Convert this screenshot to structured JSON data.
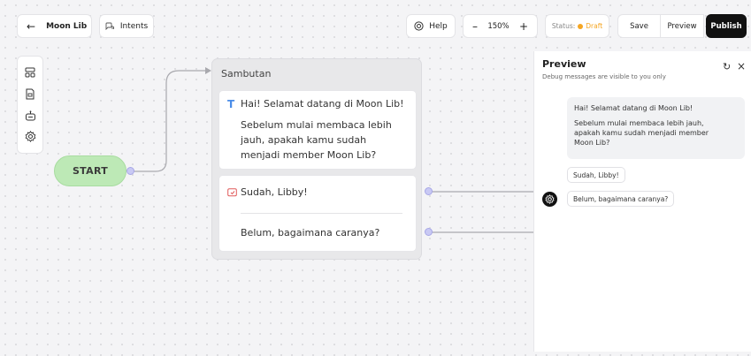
{
  "topbar": {
    "project_name": "Moon Lib",
    "intents_label": "Intents",
    "help_label": "Help",
    "zoom_level": "150%",
    "status_label": "Status:",
    "status_value": "Draft",
    "status_color": "#f5a623",
    "save_label": "Save",
    "preview_label": "Preview",
    "publish_label": "Publish"
  },
  "canvas": {
    "start_label": "START",
    "block": {
      "title": "Sambutan",
      "text_lines": [
        "Hai! Selamat datang di Moon Lib!",
        "Sebelum mulai membaca lebih",
        "jauh, apakah kamu sudah",
        "menjadi member Moon Lib?"
      ],
      "choices": [
        "Sudah, Libby!",
        "Belum, bagaimana caranya?"
      ]
    }
  },
  "preview": {
    "title": "Preview",
    "subtitle": "Debug messages are visible to you only",
    "bot_message": {
      "line1": "Hai! Selamat datang di Moon Lib!",
      "line2": "Sebelum mulai membaca lebih jauh,",
      "line3": "apakah kamu sudah menjadi member",
      "line4": "Moon Lib?"
    },
    "choices": [
      "Sudah, Libby!",
      "Belum, bagaimana caranya?"
    ]
  }
}
